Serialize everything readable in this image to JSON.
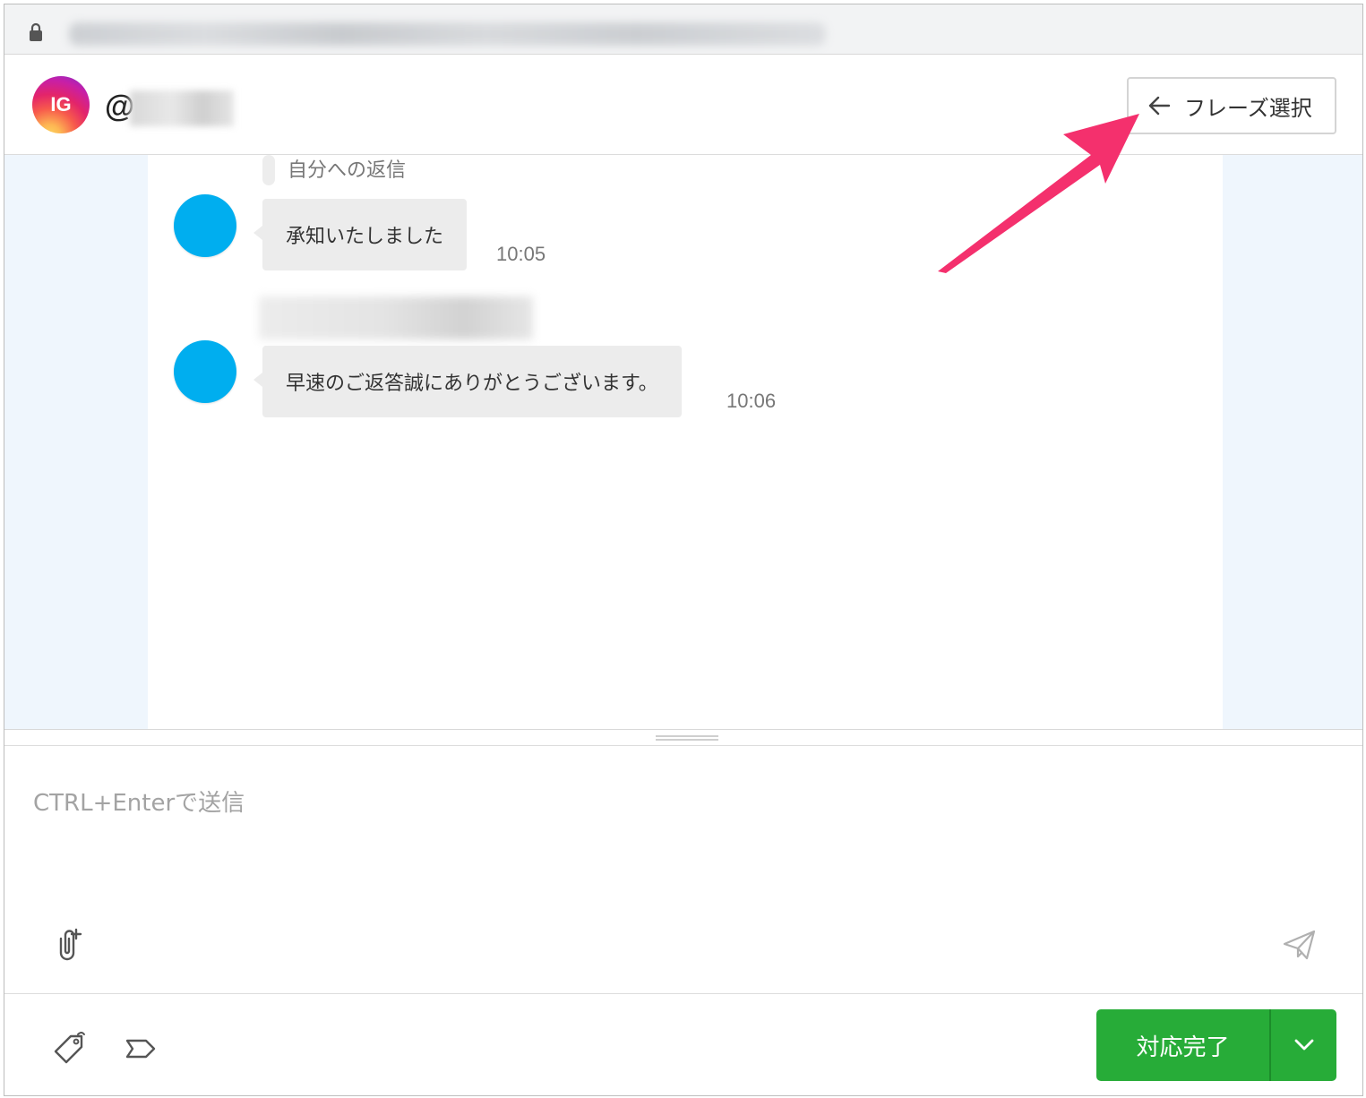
{
  "browser": {
    "lock_icon": "lock-icon"
  },
  "header": {
    "avatar_text": "IG",
    "handle_prefix": "@",
    "phrase_button_label": "フレーズ選択"
  },
  "chat": {
    "reply_label": "自分への返信",
    "messages": [
      {
        "text": "承知いたしました",
        "time": "10:05"
      },
      {
        "text": "早速のご返答誠にありがとうございます。",
        "time": "10:06"
      }
    ]
  },
  "composer": {
    "placeholder": "CTRL+Enterで送信"
  },
  "footer": {
    "done_label": "対応完了"
  },
  "colors": {
    "accent_green": "#27ac38",
    "avatar_blue": "#00aeef",
    "annotation_pink": "#f4306d",
    "chat_background": "#eff6fd"
  }
}
